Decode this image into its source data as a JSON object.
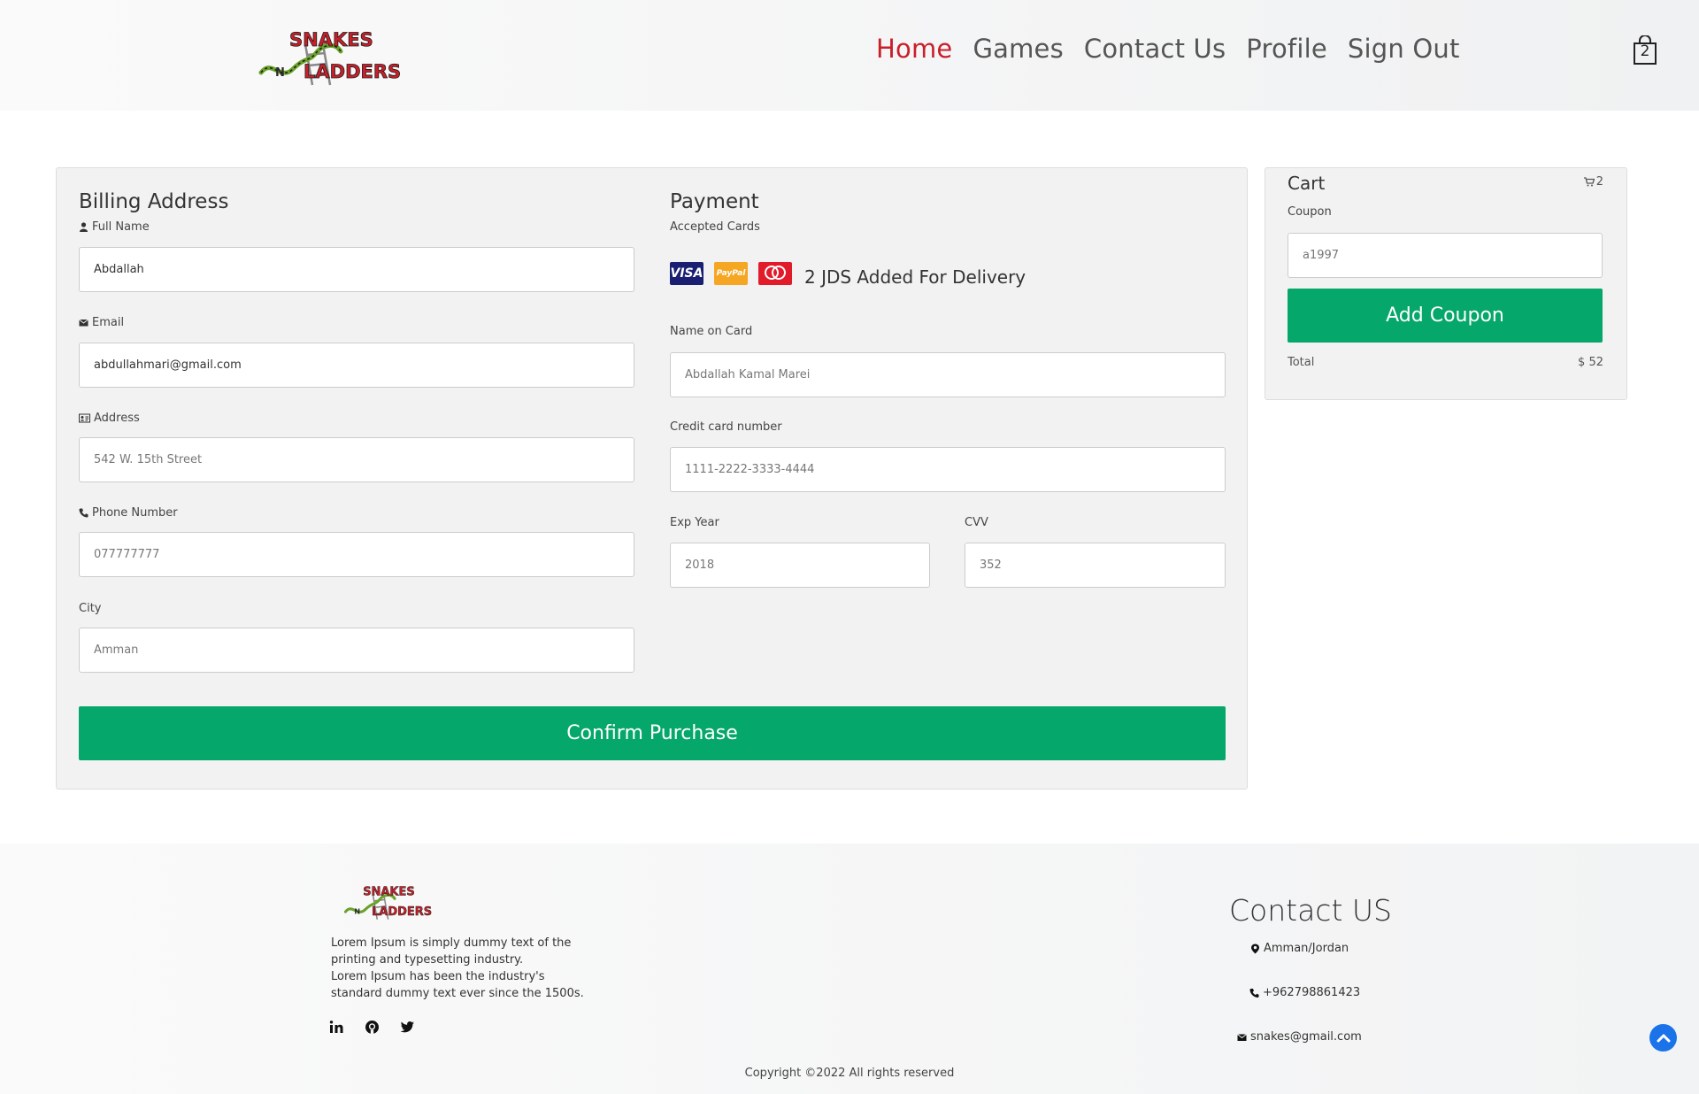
{
  "header": {
    "logo_text": "SNAKES N LADDERS",
    "nav": [
      "Home",
      "Games",
      "Contact Us",
      "Profile",
      "Sign Out"
    ],
    "cart_badge": "2"
  },
  "billing": {
    "title": "Billing Address",
    "full_name_label": "Full Name",
    "full_name_value": "Abdallah",
    "email_label": "Email",
    "email_value": "abdullahmari@gmail.com",
    "address_label": "Address",
    "address_placeholder": "542 W. 15th Street",
    "phone_label": "Phone Number",
    "phone_placeholder": "077777777",
    "city_label": "City",
    "city_placeholder": "Amman"
  },
  "payment": {
    "title": "Payment",
    "accepted_label": "Accepted Cards",
    "cards": [
      "VISA",
      "PayPal",
      "mastercard"
    ],
    "delivery_note": "2 JDS Added For Delivery",
    "name_on_card_label": "Name on Card",
    "name_on_card_placeholder": "Abdallah Kamal Marei",
    "card_number_label": "Credit card number",
    "card_number_placeholder": "1111-2222-3333-4444",
    "exp_year_label": "Exp Year",
    "exp_year_placeholder": "2018",
    "cvv_label": "CVV",
    "cvv_placeholder": "352"
  },
  "confirm_label": "Confirm Purchase",
  "cart": {
    "title": "Cart",
    "count": "2",
    "coupon_label": "Coupon",
    "coupon_placeholder": "a1997",
    "add_coupon_label": "Add Coupon",
    "total_label": "Total",
    "total_value": "$ 52"
  },
  "footer": {
    "description_1": "Lorem Ipsum is simply dummy text of the printing and typesetting industry.",
    "description_2": "Lorem Ipsum has been the industry's standard dummy text ever since the 1500s.",
    "social": [
      "linkedin-icon",
      "github-icon",
      "twitter-icon"
    ],
    "contact_title": "Contact US",
    "location": "Amman/Jordan",
    "phone": "+962798861423",
    "email": "snakes@gmail.com",
    "copyright": "Copyright ©2022 All rights reserved"
  },
  "colors": {
    "accent_red": "#c8202a",
    "button_green": "#06a76b",
    "scroll_top_blue": "#1a73e8"
  }
}
